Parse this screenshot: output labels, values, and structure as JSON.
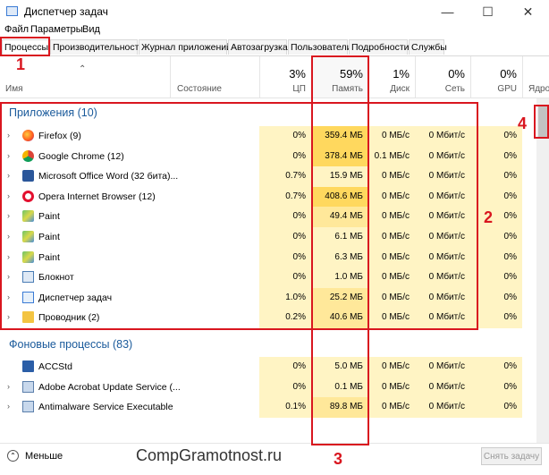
{
  "window": {
    "title": "Диспетчер задач",
    "min": "—",
    "max": "☐",
    "close": "✕"
  },
  "menu": [
    "Файл",
    "Параметры",
    "Вид"
  ],
  "tabs": [
    "Процессы",
    "Производительность",
    "Журнал приложений",
    "Автозагрузка",
    "Пользователи",
    "Подробности",
    "Службы"
  ],
  "columns": {
    "name": "Имя",
    "status": "Состояние",
    "cpu": {
      "pct": "3%",
      "label": "ЦП"
    },
    "mem": {
      "pct": "59%",
      "label": "Память"
    },
    "disk": {
      "pct": "1%",
      "label": "Диск"
    },
    "net": {
      "pct": "0%",
      "label": "Сеть"
    },
    "gpu": {
      "pct": "0%",
      "label": "GPU"
    },
    "engine": "Ядро"
  },
  "groups": {
    "apps": "Приложения (10)",
    "background": "Фоновые процессы (83)"
  },
  "apps": [
    {
      "name": "Firefox (9)",
      "cpu": "0%",
      "mem": "359.4 МБ",
      "disk": "0 МБ/с",
      "net": "0 Мбит/с",
      "gpu": "0%",
      "icon": "firefox-icon"
    },
    {
      "name": "Google Chrome (12)",
      "cpu": "0%",
      "mem": "378.4 МБ",
      "disk": "0.1 МБ/с",
      "net": "0 Мбит/с",
      "gpu": "0%",
      "icon": "chrome-icon"
    },
    {
      "name": "Microsoft Office Word (32 бита)...",
      "cpu": "0.7%",
      "mem": "15.9 МБ",
      "disk": "0 МБ/с",
      "net": "0 Мбит/с",
      "gpu": "0%",
      "icon": "word-icon"
    },
    {
      "name": "Opera Internet Browser (12)",
      "cpu": "0.7%",
      "mem": "408.6 МБ",
      "disk": "0 МБ/с",
      "net": "0 Мбит/с",
      "gpu": "0%",
      "icon": "opera-icon"
    },
    {
      "name": "Paint",
      "cpu": "0%",
      "mem": "49.4 МБ",
      "disk": "0 МБ/с",
      "net": "0 Мбит/с",
      "gpu": "0%",
      "icon": "paint-icon"
    },
    {
      "name": "Paint",
      "cpu": "0%",
      "mem": "6.1 МБ",
      "disk": "0 МБ/с",
      "net": "0 Мбит/с",
      "gpu": "0%",
      "icon": "paint-icon"
    },
    {
      "name": "Paint",
      "cpu": "0%",
      "mem": "6.3 МБ",
      "disk": "0 МБ/с",
      "net": "0 Мбит/с",
      "gpu": "0%",
      "icon": "paint-icon"
    },
    {
      "name": "Блокнот",
      "cpu": "0%",
      "mem": "1.0 МБ",
      "disk": "0 МБ/с",
      "net": "0 Мбит/с",
      "gpu": "0%",
      "icon": "notepad-icon"
    },
    {
      "name": "Диспетчер задач",
      "cpu": "1.0%",
      "mem": "25.2 МБ",
      "disk": "0 МБ/с",
      "net": "0 Мбит/с",
      "gpu": "0%",
      "icon": "taskmgr-icon"
    },
    {
      "name": "Проводник (2)",
      "cpu": "0.2%",
      "mem": "40.6 МБ",
      "disk": "0 МБ/с",
      "net": "0 Мбит/с",
      "gpu": "0%",
      "icon": "explorer-icon"
    }
  ],
  "background": [
    {
      "name": "ACCStd",
      "cpu": "0%",
      "mem": "5.0 МБ",
      "disk": "0 МБ/с",
      "net": "0 Мбит/с",
      "gpu": "0%",
      "icon": "app-icon",
      "expand": false
    },
    {
      "name": "Adobe Acrobat Update Service (...",
      "cpu": "0%",
      "mem": "0.1 МБ",
      "disk": "0 МБ/с",
      "net": "0 Мбит/с",
      "gpu": "0%",
      "icon": "service-icon",
      "expand": true
    },
    {
      "name": "Antimalware Service Executable",
      "cpu": "0.1%",
      "mem": "89.8 МБ",
      "disk": "0 МБ/с",
      "net": "0 Мбит/с",
      "gpu": "0%",
      "icon": "service-icon",
      "expand": true
    }
  ],
  "bottom": {
    "less": "Меньше",
    "end_task": "Снять задачу",
    "watermark": "CompGramotnost.ru"
  },
  "annotations": [
    "1",
    "2",
    "3",
    "4"
  ],
  "colors": {
    "accent": "#1a5a9b",
    "annotation": "#d9161f",
    "heat_light": "#fff4c4",
    "heat_mid": "#ffe89a",
    "heat_strong": "#ffd85e"
  }
}
